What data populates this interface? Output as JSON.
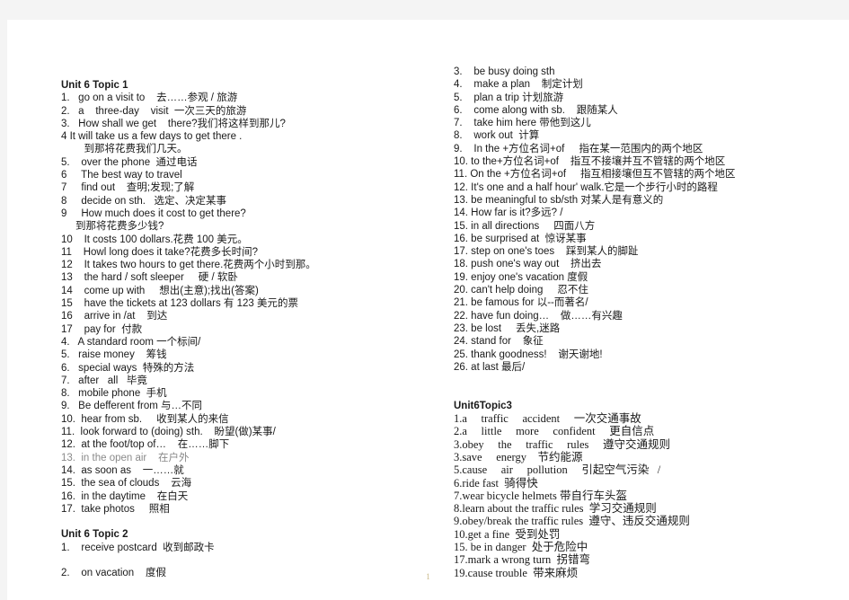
{
  "document": {
    "page_number": "1",
    "left_column": [
      {
        "text": "Unit 6 Topic 1",
        "style": "bold"
      },
      {
        "text": "1.   go on a visit to    去……参观 / 旅游",
        "style": "normal"
      },
      {
        "text": "2.   a    three-day    visit  一次三天的旅游",
        "style": "normal"
      },
      {
        "text": "3.   How shall we get    there?我们将这样到那儿?",
        "style": "normal"
      },
      {
        "text": "4 It will take us a few days to get there .",
        "style": "normal"
      },
      {
        "text": "        到那将花费我们几天。",
        "style": "normal"
      },
      {
        "text": "5.    over the phone  通过电话",
        "style": "normal"
      },
      {
        "text": "6     The best way to travel",
        "style": "normal"
      },
      {
        "text": "7     find out    查明;发现;了解",
        "style": "normal"
      },
      {
        "text": "8     decide on sth.   选定、决定某事",
        "style": "normal"
      },
      {
        "text": "9     How much does it cost to get there?",
        "style": "normal"
      },
      {
        "text": "     到那将花费多少钱?",
        "style": "normal"
      },
      {
        "text": "10    It costs 100 dollars.花费 100 美元。",
        "style": "normal"
      },
      {
        "text": "11    Howl long does it take?花费多长时间?",
        "style": "normal"
      },
      {
        "text": "12    It takes two hours to get there.花费两个小时到那。",
        "style": "normal"
      },
      {
        "text": "13    the hard / soft sleeper     硬 / 软卧",
        "style": "normal"
      },
      {
        "text": "14    come up with     想出(主意);找出(答案)",
        "style": "normal"
      },
      {
        "text": "15    have the tickets at 123 dollars 有 123 美元的票",
        "style": "normal"
      },
      {
        "text": "16    arrive in /at    到达",
        "style": "normal"
      },
      {
        "text": "17    pay for  付款",
        "style": "normal"
      },
      {
        "text": "4.   A standard room 一个标间/",
        "style": "normal"
      },
      {
        "text": "5.   raise money    筹钱",
        "style": "normal"
      },
      {
        "text": "6.   special ways  特殊的方法",
        "style": "normal"
      },
      {
        "text": "7.   after   all   毕竟",
        "style": "normal"
      },
      {
        "text": "8.   mobile phone  手机",
        "style": "normal"
      },
      {
        "text": "9.   Be defferent from 与…不同",
        "style": "normal"
      },
      {
        "text": "10.  hear from sb.     收到某人的来信",
        "style": "normal"
      },
      {
        "text": "11.  look forward to (doing) sth.    盼望(做)某事/",
        "style": "normal"
      },
      {
        "text": "12.  at the foot/top of…    在……脚下",
        "style": "normal"
      },
      {
        "text": "13.  in the open air    在户外",
        "style": "faint"
      },
      {
        "text": "14.  as soon as    一……就",
        "style": "normal"
      },
      {
        "text": "15.  the sea of clouds    云海",
        "style": "normal"
      },
      {
        "text": "16.  in the daytime    在白天",
        "style": "normal"
      },
      {
        "text": "17.  take photos     照相",
        "style": "normal"
      },
      {
        "text": "",
        "style": "spacer"
      },
      {
        "text": "Unit 6 Topic 2",
        "style": "bold"
      },
      {
        "text": "1.    receive postcard  收到邮政卡",
        "style": "normal"
      },
      {
        "text": "",
        "style": "spacer"
      },
      {
        "text": "2.    on vacation    度假",
        "style": "normal"
      }
    ],
    "right_column": [
      {
        "text": "3.    be busy doing sth",
        "style": "normal"
      },
      {
        "text": "4.    make a plan    制定计划",
        "style": "normal"
      },
      {
        "text": "5.    plan a trip 计划旅游",
        "style": "normal"
      },
      {
        "text": "6.    come along with sb.    跟随某人",
        "style": "normal"
      },
      {
        "text": "7.    take him here 带他到这儿",
        "style": "normal"
      },
      {
        "text": "8.    work out  计算",
        "style": "normal"
      },
      {
        "text": "9.    In the +方位名词+of     指在某一范围内的两个地区",
        "style": "normal"
      },
      {
        "text": "10. to the+方位名词+of    指互不接壤并互不管辖的两个地区",
        "style": "normal"
      },
      {
        "text": "11. On the +方位名词+of     指互相接壤但互不管辖的两个地区",
        "style": "normal"
      },
      {
        "text": "12. It's one and a half hour' walk.它是一个步行小时的路程",
        "style": "normal"
      },
      {
        "text": "13. be meaningful to sb/sth 对某人是有意义的",
        "style": "normal"
      },
      {
        "text": "14. How far is it?多远? /",
        "style": "normal"
      },
      {
        "text": "15. in all directions     四面八方",
        "style": "normal"
      },
      {
        "text": "16. be surprised at  惊讶某事",
        "style": "normal"
      },
      {
        "text": "17. step on one's toes    踩到某人的脚趾",
        "style": "normal"
      },
      {
        "text": "18. push one's way out    挤出去",
        "style": "normal"
      },
      {
        "text": "19. enjoy one's vacation 度假",
        "style": "normal"
      },
      {
        "text": "20. can't help doing     忍不住",
        "style": "normal"
      },
      {
        "text": "21. be famous for 以--而著名/",
        "style": "normal"
      },
      {
        "text": "22. have fun doing…    做……有兴趣",
        "style": "normal"
      },
      {
        "text": "23. be lost     丢失,迷路",
        "style": "normal"
      },
      {
        "text": "24. stand for    象征",
        "style": "normal"
      },
      {
        "text": "25. thank goodness!    谢天谢地!",
        "style": "normal"
      },
      {
        "text": "26. at last 最后/",
        "style": "normal"
      },
      {
        "text": "",
        "style": "spacer"
      },
      {
        "text": "",
        "style": "spacer"
      },
      {
        "text": "Unit6Topic3",
        "style": "serif-bold"
      },
      {
        "text": "1.a     traffic     accident     一次交通事故",
        "style": "serif"
      },
      {
        "text": "2.a     little     more     confident     更自信点",
        "style": "serif"
      },
      {
        "text": "3.obey     the     traffic     rules     遵守交通规则",
        "style": "serif"
      },
      {
        "text": "3.save     energy    节约能源",
        "style": "serif"
      },
      {
        "text": "5.cause     air     pollution     引起空气污染   /",
        "style": "serif"
      },
      {
        "text": "6.ride fast  骑得快",
        "style": "serif"
      },
      {
        "text": "7.wear bicycle helmets 带自行车头盔",
        "style": "serif"
      },
      {
        "text": "8.learn about the traffic rules  学习交通规则",
        "style": "serif"
      },
      {
        "text": "9.obey/break the traffic rules  遵守、违反交通规则",
        "style": "serif"
      },
      {
        "text": "10.get a fine  受到处罚",
        "style": "serif"
      },
      {
        "text": "15. be in danger  处于危险中",
        "style": "serif"
      },
      {
        "text": "17.mark a wrong turn  拐错弯",
        "style": "serif"
      },
      {
        "text": "19.cause trouble  带来麻烦",
        "style": "serif"
      }
    ]
  }
}
